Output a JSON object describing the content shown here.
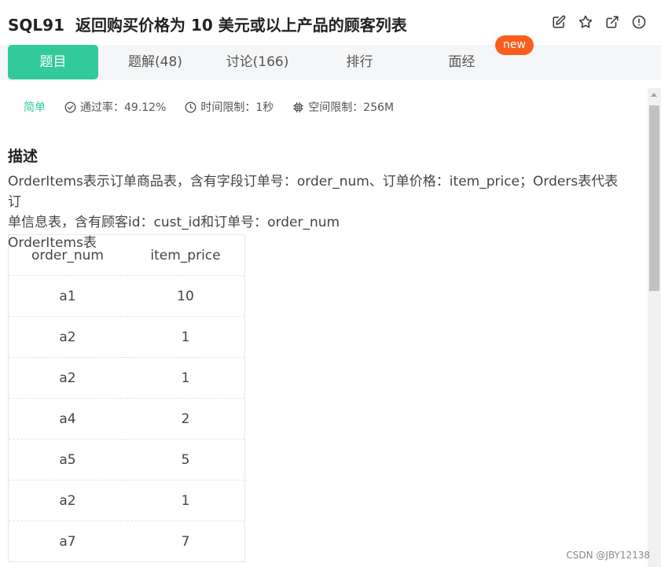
{
  "header": {
    "problem_code": "SQL91",
    "problem_title": "返回购买价格为 10 美元或以上产品的顾客列表",
    "icons": [
      "edit-icon",
      "star-icon",
      "external-link-icon",
      "alert-circle-icon"
    ]
  },
  "tabs": [
    {
      "label": "题目",
      "active": true
    },
    {
      "label": "题解(48)",
      "active": false
    },
    {
      "label": "讨论(166)",
      "active": false
    },
    {
      "label": "排行",
      "active": false
    },
    {
      "label": "面经",
      "active": false
    }
  ],
  "new_badge": "new",
  "meta": {
    "difficulty": "简单",
    "pass_rate": "通过率：49.12%",
    "time_limit": "时间限制：1秒",
    "space_limit": "空间限制：256M"
  },
  "section": {
    "title": "描述"
  },
  "description": {
    "line1": "OrderItems表示订单商品表，含有字段订单号：order_num、订单价格：item_price；Orders表代表订",
    "line2": "单信息表，含有顾客id：cust_id和订单号：order_num",
    "table_caption": "OrderItems表"
  },
  "table": {
    "headers": [
      "order_num",
      "item_price"
    ],
    "rows": [
      [
        "a1",
        "10"
      ],
      [
        "a2",
        "1"
      ],
      [
        "a2",
        "1"
      ],
      [
        "a4",
        "2"
      ],
      [
        "a5",
        "5"
      ],
      [
        "a2",
        "1"
      ],
      [
        "a7",
        "7"
      ]
    ]
  },
  "watermark": "CSDN @JBY12138",
  "colors": {
    "accent": "#32ca99",
    "new_badge": "#fa5e1e",
    "tab_bar": "#f5f6f7"
  }
}
